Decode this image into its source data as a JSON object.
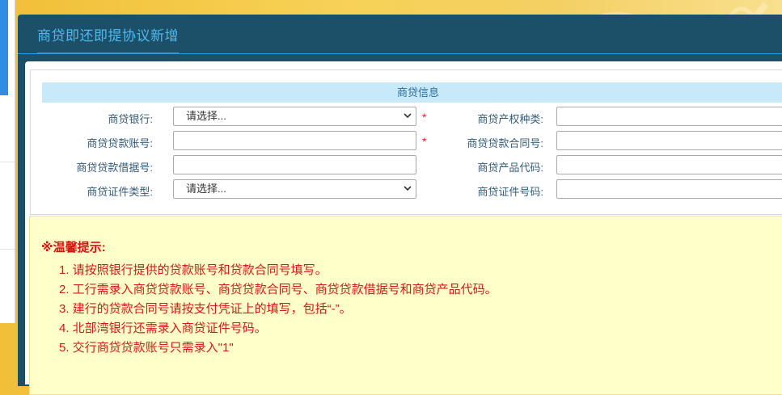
{
  "dialog": {
    "title": "商贷即还即提协议新增"
  },
  "section": {
    "heading": "商贷信息"
  },
  "form": {
    "bank": {
      "label": "商贷银行:",
      "value": "请选择...",
      "required_mark": "*"
    },
    "property_type": {
      "label": "商贷产权种类:",
      "value": ""
    },
    "loan_account": {
      "label": "商贷贷款账号:",
      "value": "",
      "required_mark": "*"
    },
    "loan_contract": {
      "label": "商贷贷款合同号:",
      "value": ""
    },
    "loan_receipt": {
      "label": "商贷贷款借据号:",
      "value": ""
    },
    "product_code": {
      "label": "商贷产品代码:",
      "value": ""
    },
    "id_type": {
      "label": "商贷证件类型:",
      "value": "请选择..."
    },
    "id_number": {
      "label": "商贷证件号码:",
      "value": ""
    }
  },
  "tips": {
    "title": "※温馨提示:",
    "items": [
      "1. 请按照银行提供的贷款账号和贷款合同号填写。",
      "2. 工行需录入商贷贷款账号、商贷贷款合同号、商贷贷款借据号和商贷产品代码。",
      "3. 建行的贷款合同号请按支付凭证上的填写，包括“-”。",
      "4. 北部湾银行还需录入商贷证件号码。",
      "5. 交行商贷贷款账号只需录入\"1\""
    ]
  },
  "colors": {
    "header_bg": "#1c4f68",
    "title_accent": "#4fb9ee",
    "section_bg": "#c7e9fa",
    "tip_bg": "#ffffc9",
    "tip_text": "#d21a1a"
  },
  "icons": [
    "chevron-down-icon"
  ]
}
